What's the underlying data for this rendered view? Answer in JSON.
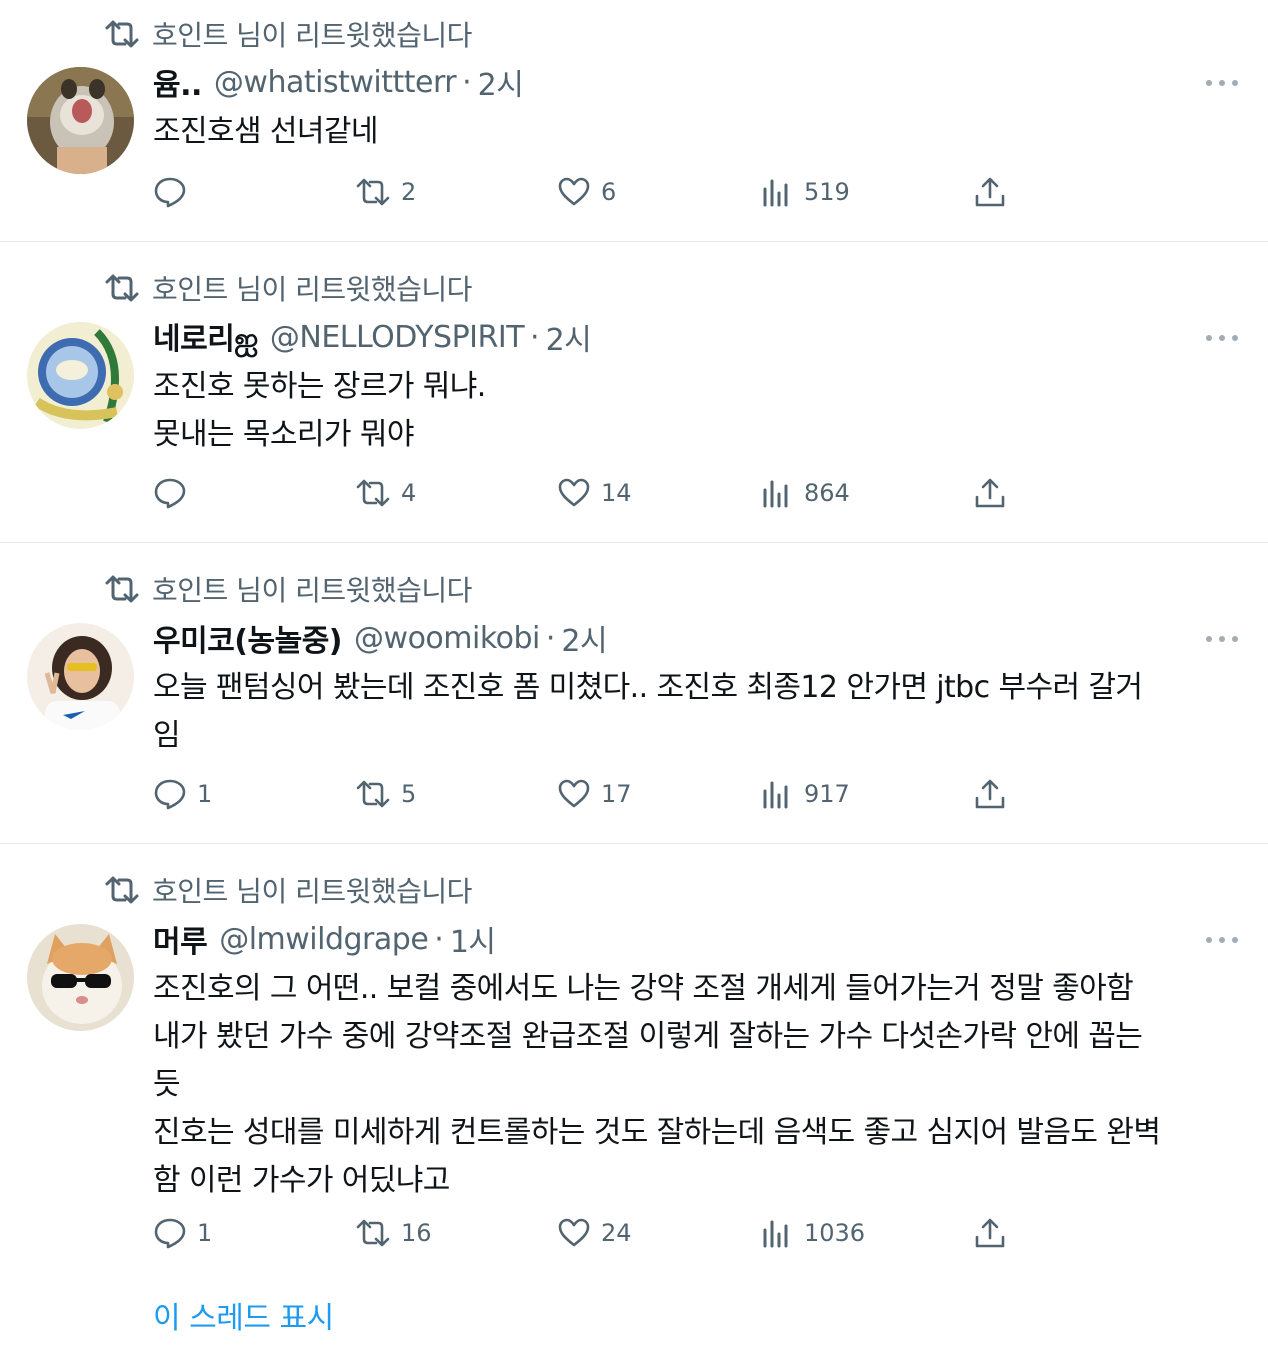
{
  "colors": {
    "accent": "#1d9bf0",
    "secondary_text": "#536471",
    "divider": "#e6e9ec"
  },
  "tweets": [
    {
      "retweeted_by": "호인트 님이 리트윗했습니다",
      "name": "윰..",
      "handle": "@whatistwittterr",
      "dot": "·",
      "time": "2시",
      "text": "조진호샘 선녀같네",
      "reply_count": "",
      "retweet_count": "2",
      "like_count": "6",
      "view_count": "519"
    },
    {
      "retweeted_by": "호인트 님이 리트윗했습니다",
      "name": "네로리ஐ",
      "handle": "@NELLODYSPIRIT",
      "dot": "·",
      "time": "2시",
      "text": "조진호 못하는 장르가 뭐냐.\n못내는 목소리가 뭐야",
      "reply_count": "",
      "retweet_count": "4",
      "like_count": "14",
      "view_count": "864"
    },
    {
      "retweeted_by": "호인트 님이 리트윗했습니다",
      "name": "우미코(농놀중)",
      "handle": "@woomikobi",
      "dot": "·",
      "time": "2시",
      "text": "오늘 팬텀싱어 봤는데 조진호 폼 미쳤다.. 조진호 최종12 안가면 jtbc 부수러 갈거\n임",
      "reply_count": "1",
      "retweet_count": "5",
      "like_count": "17",
      "view_count": "917"
    },
    {
      "retweeted_by": "호인트 님이 리트윗했습니다",
      "name": "머루",
      "handle": "@lmwildgrape",
      "dot": "·",
      "time": "1시",
      "text": "조진호의 그 어떤.. 보컬 중에서도 나는 강약 조절 개세게 들어가는거 정말 좋아함\n내가 봤던 가수 중에 강약조절 완급조절 이렇게 잘하는 가수 다섯손가락 안에 꼽는\n듯\n진호는 성대를 미세하게 컨트롤하는 것도 잘하는데 음색도 좋고 심지어 발음도 완벽\n함 이런 가수가 어딨냐고",
      "reply_count": "1",
      "retweet_count": "16",
      "like_count": "24",
      "view_count": "1036"
    }
  ],
  "show_thread_label": "이 스레드 표시"
}
